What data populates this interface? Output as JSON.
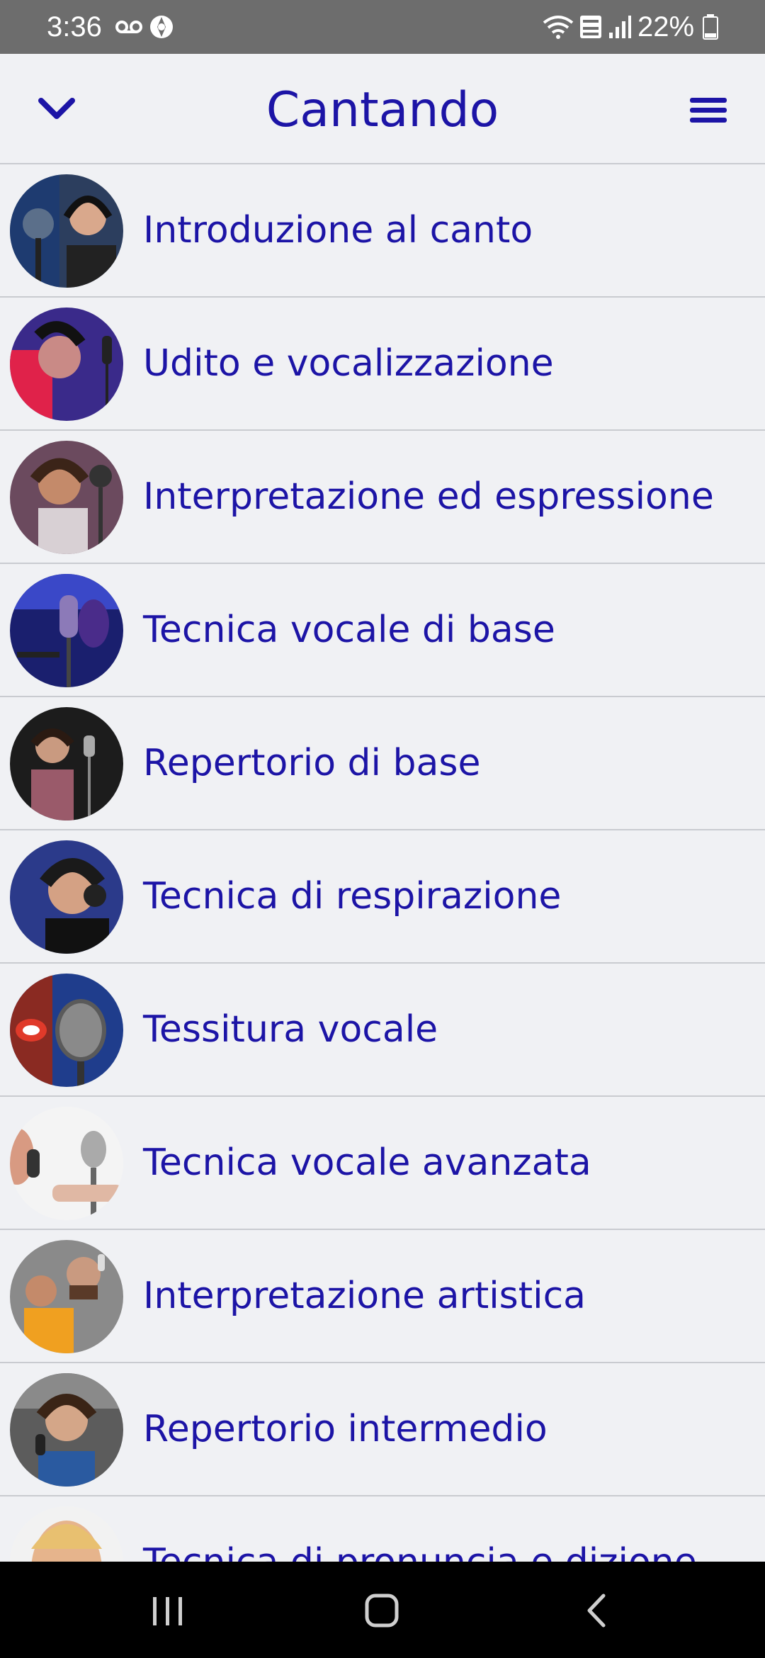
{
  "status": {
    "time": "3:36",
    "battery": "22%",
    "icons": [
      "voicemail-icon",
      "vpn-icon",
      "wifi-icon",
      "voz-wifi-icon",
      "signal-icon",
      "battery-icon"
    ]
  },
  "header": {
    "title": "Cantando",
    "back_icon": "chevron-down-icon",
    "menu_icon": "hamburger-menu-icon"
  },
  "colors": {
    "accent": "#1c14a6",
    "background": "#f0f1f4",
    "divider": "#c9cbd0"
  },
  "items": [
    {
      "label": "Introduzione al canto"
    },
    {
      "label": "Udito e vocalizzazione"
    },
    {
      "label": "Interpretazione ed espressione"
    },
    {
      "label": "Tecnica vocale di base"
    },
    {
      "label": "Repertorio di base"
    },
    {
      "label": "Tecnica di respirazione"
    },
    {
      "label": "Tessitura vocale"
    },
    {
      "label": "Tecnica vocale avanzata"
    },
    {
      "label": "Interpretazione artistica"
    },
    {
      "label": "Repertorio intermedio"
    },
    {
      "label": "Tecnica di pronuncia e dizione"
    }
  ],
  "nav": {
    "icons": [
      "recent-apps-icon",
      "home-icon",
      "back-icon"
    ]
  }
}
